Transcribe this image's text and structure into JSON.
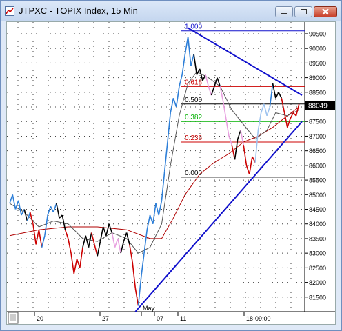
{
  "window": {
    "title": "JTPXC - TOPIX Index, 15 Min",
    "app_icon": "chart-app-icon",
    "buttons": {
      "minimize": "minimize-icon",
      "maximize": "maximize-icon",
      "close": "close-icon"
    }
  },
  "chart_data": {
    "type": "line",
    "symbol": "JTPXC",
    "y_ticks": [
      "90500",
      "90000",
      "89500",
      "89000",
      "88500",
      "88000",
      "87500",
      "87000",
      "86500",
      "86000",
      "85500",
      "85000",
      "84500",
      "84000",
      "83500",
      "83000",
      "82500",
      "82000",
      "81500"
    ],
    "current_price_label": "88049",
    "x_ticks": [
      "20",
      "27",
      "May",
      "07",
      "11",
      "18-09:00"
    ],
    "fibonacci_levels": [
      {
        "ratio": "1.000",
        "value": 90600,
        "color": "#1010cc"
      },
      {
        "ratio": "0.618",
        "value": 88700,
        "color": "#cc0000"
      },
      {
        "ratio": "0.500",
        "value": 88100,
        "color": "#000000"
      },
      {
        "ratio": "0.382",
        "value": 87500,
        "color": "#00b000"
      },
      {
        "ratio": "0.236",
        "value": 86800,
        "color": "#cc0000"
      },
      {
        "ratio": "0.000",
        "value": 85600,
        "color": "#000000"
      }
    ],
    "ylim": [
      81000,
      90900
    ],
    "price_series": [
      {
        "x": 0,
        "y": 84700,
        "c": "#2e7fd8"
      },
      {
        "x": 2,
        "y": 85000,
        "c": "#2e7fd8"
      },
      {
        "x": 4,
        "y": 84500,
        "c": "#2e7fd8"
      },
      {
        "x": 6,
        "y": 84800,
        "c": "#2e7fd8"
      },
      {
        "x": 8,
        "y": 84300,
        "c": "#2e7fd8"
      },
      {
        "x": 10,
        "y": 84500,
        "c": "#2e7fd8"
      },
      {
        "x": 12,
        "y": 84100,
        "c": "#000000"
      },
      {
        "x": 14,
        "y": 84400,
        "c": "#2e7fd8"
      },
      {
        "x": 16,
        "y": 84000,
        "c": "#cc0000"
      },
      {
        "x": 18,
        "y": 83300,
        "c": "#cc0000"
      },
      {
        "x": 20,
        "y": 83800,
        "c": "#cc0000"
      },
      {
        "x": 22,
        "y": 83200,
        "c": "#cc0000"
      },
      {
        "x": 24,
        "y": 83600,
        "c": "#2e7fd8"
      },
      {
        "x": 26,
        "y": 84300,
        "c": "#2e7fd8"
      },
      {
        "x": 28,
        "y": 84600,
        "c": "#2e7fd8"
      },
      {
        "x": 30,
        "y": 84400,
        "c": "#2e7fd8"
      },
      {
        "x": 32,
        "y": 84700,
        "c": "#2e7fd8"
      },
      {
        "x": 34,
        "y": 84200,
        "c": "#000000"
      },
      {
        "x": 36,
        "y": 84300,
        "c": "#000000"
      },
      {
        "x": 38,
        "y": 83800,
        "c": "#000000"
      },
      {
        "x": 40,
        "y": 83500,
        "c": "#cc0000"
      },
      {
        "x": 42,
        "y": 83000,
        "c": "#cc0000"
      },
      {
        "x": 44,
        "y": 82300,
        "c": "#cc0000"
      },
      {
        "x": 46,
        "y": 82800,
        "c": "#cc0000"
      },
      {
        "x": 48,
        "y": 82500,
        "c": "#cc0000"
      },
      {
        "x": 50,
        "y": 83200,
        "c": "#cc0000"
      },
      {
        "x": 52,
        "y": 83600,
        "c": "#000000"
      },
      {
        "x": 54,
        "y": 83200,
        "c": "#000000"
      },
      {
        "x": 56,
        "y": 83700,
        "c": "#000000"
      },
      {
        "x": 58,
        "y": 83300,
        "c": "#cc0000"
      },
      {
        "x": 60,
        "y": 82900,
        "c": "#cc0000"
      },
      {
        "x": 62,
        "y": 83400,
        "c": "#000000"
      },
      {
        "x": 64,
        "y": 83900,
        "c": "#000000"
      },
      {
        "x": 66,
        "y": 83600,
        "c": "#000000"
      },
      {
        "x": 68,
        "y": 84000,
        "c": "#000000"
      },
      {
        "x": 70,
        "y": 83700,
        "c": "#000000"
      },
      {
        "x": 72,
        "y": 83200,
        "c": "#e8a0e0"
      },
      {
        "x": 74,
        "y": 83500,
        "c": "#e8a0e0"
      },
      {
        "x": 76,
        "y": 83000,
        "c": "#e8a0e0"
      },
      {
        "x": 78,
        "y": 83400,
        "c": "#000000"
      },
      {
        "x": 80,
        "y": 83700,
        "c": "#000000"
      },
      {
        "x": 82,
        "y": 83300,
        "c": "#000000"
      },
      {
        "x": 84,
        "y": 82700,
        "c": "#cc0000"
      },
      {
        "x": 86,
        "y": 81800,
        "c": "#cc0000"
      },
      {
        "x": 88,
        "y": 81200,
        "c": "#cc0000"
      },
      {
        "x": 90,
        "y": 82200,
        "c": "#2e7fd8"
      },
      {
        "x": 92,
        "y": 83000,
        "c": "#2e7fd8"
      },
      {
        "x": 94,
        "y": 83800,
        "c": "#2e7fd8"
      },
      {
        "x": 96,
        "y": 84300,
        "c": "#2e7fd8"
      },
      {
        "x": 98,
        "y": 84000,
        "c": "#2e7fd8"
      },
      {
        "x": 100,
        "y": 84700,
        "c": "#2e7fd8"
      },
      {
        "x": 102,
        "y": 84300,
        "c": "#2e7fd8"
      },
      {
        "x": 104,
        "y": 84800,
        "c": "#2e7fd8"
      },
      {
        "x": 106,
        "y": 85800,
        "c": "#2e7fd8"
      },
      {
        "x": 108,
        "y": 86800,
        "c": "#2e7fd8"
      },
      {
        "x": 110,
        "y": 87800,
        "c": "#2e7fd8"
      },
      {
        "x": 112,
        "y": 88300,
        "c": "#2e7fd8"
      },
      {
        "x": 114,
        "y": 88000,
        "c": "#2e7fd8"
      },
      {
        "x": 116,
        "y": 88700,
        "c": "#2e7fd8"
      },
      {
        "x": 118,
        "y": 89100,
        "c": "#2e7fd8"
      },
      {
        "x": 120,
        "y": 89800,
        "c": "#2e7fd8"
      },
      {
        "x": 122,
        "y": 90400,
        "c": "#2e7fd8"
      },
      {
        "x": 124,
        "y": 89400,
        "c": "#2e7fd8"
      },
      {
        "x": 126,
        "y": 89800,
        "c": "#2e7fd8"
      },
      {
        "x": 128,
        "y": 89100,
        "c": "#000000"
      },
      {
        "x": 130,
        "y": 89300,
        "c": "#000000"
      },
      {
        "x": 132,
        "y": 88900,
        "c": "#000000"
      },
      {
        "x": 134,
        "y": 89100,
        "c": "#000000"
      },
      {
        "x": 136,
        "y": 88700,
        "c": "#e8a0e0"
      },
      {
        "x": 138,
        "y": 88400,
        "c": "#e8a0e0"
      },
      {
        "x": 140,
        "y": 88700,
        "c": "#000000"
      },
      {
        "x": 142,
        "y": 89000,
        "c": "#000000"
      },
      {
        "x": 144,
        "y": 88700,
        "c": "#000000"
      },
      {
        "x": 146,
        "y": 88200,
        "c": "#e8a0e0"
      },
      {
        "x": 148,
        "y": 87600,
        "c": "#e8a0e0"
      },
      {
        "x": 150,
        "y": 87000,
        "c": "#e8a0e0"
      },
      {
        "x": 152,
        "y": 86700,
        "c": "#e8a0e0"
      },
      {
        "x": 154,
        "y": 86200,
        "c": "#cc0000"
      },
      {
        "x": 156,
        "y": 86900,
        "c": "#000000"
      },
      {
        "x": 158,
        "y": 87200,
        "c": "#000000"
      },
      {
        "x": 160,
        "y": 86700,
        "c": "#e8a0e0"
      },
      {
        "x": 162,
        "y": 86000,
        "c": "#cc0000"
      },
      {
        "x": 164,
        "y": 85700,
        "c": "#cc0000"
      },
      {
        "x": 166,
        "y": 86300,
        "c": "#cc0000"
      },
      {
        "x": 168,
        "y": 86100,
        "c": "#cc0000"
      },
      {
        "x": 170,
        "y": 87200,
        "c": "#9ec3ef"
      },
      {
        "x": 172,
        "y": 87800,
        "c": "#9ec3ef"
      },
      {
        "x": 174,
        "y": 88100,
        "c": "#9ec3ef"
      },
      {
        "x": 176,
        "y": 87700,
        "c": "#9ec3ef"
      },
      {
        "x": 178,
        "y": 88000,
        "c": "#9ec3ef"
      },
      {
        "x": 180,
        "y": 88800,
        "c": "#2e7fd8"
      },
      {
        "x": 182,
        "y": 88300,
        "c": "#000000"
      },
      {
        "x": 184,
        "y": 88500,
        "c": "#000000"
      },
      {
        "x": 186,
        "y": 88300,
        "c": "#000000"
      },
      {
        "x": 188,
        "y": 87800,
        "c": "#cc0000"
      },
      {
        "x": 190,
        "y": 87300,
        "c": "#cc0000"
      },
      {
        "x": 192,
        "y": 87600,
        "c": "#cc0000"
      },
      {
        "x": 194,
        "y": 87800,
        "c": "#cc0000"
      },
      {
        "x": 196,
        "y": 87700,
        "c": "#cc0000"
      },
      {
        "x": 198,
        "y": 88100,
        "c": "#cc0000"
      }
    ],
    "x_max": 200,
    "ma_fast": [
      {
        "x": 0,
        "y": 84700
      },
      {
        "x": 10,
        "y": 84400
      },
      {
        "x": 20,
        "y": 83900
      },
      {
        "x": 30,
        "y": 84100
      },
      {
        "x": 40,
        "y": 84000
      },
      {
        "x": 50,
        "y": 83500
      },
      {
        "x": 60,
        "y": 83400
      },
      {
        "x": 70,
        "y": 83700
      },
      {
        "x": 80,
        "y": 83500
      },
      {
        "x": 88,
        "y": 83000
      },
      {
        "x": 96,
        "y": 83200
      },
      {
        "x": 104,
        "y": 84000
      },
      {
        "x": 110,
        "y": 86000
      },
      {
        "x": 116,
        "y": 87700
      },
      {
        "x": 122,
        "y": 88800
      },
      {
        "x": 128,
        "y": 89200
      },
      {
        "x": 136,
        "y": 89000
      },
      {
        "x": 144,
        "y": 88700
      },
      {
        "x": 152,
        "y": 87900
      },
      {
        "x": 160,
        "y": 87400
      },
      {
        "x": 168,
        "y": 86900
      },
      {
        "x": 176,
        "y": 87200
      },
      {
        "x": 182,
        "y": 87800
      },
      {
        "x": 190,
        "y": 87700
      },
      {
        "x": 198,
        "y": 87900
      }
    ],
    "ma_slow": [
      {
        "x": 0,
        "y": 83600
      },
      {
        "x": 20,
        "y": 83800
      },
      {
        "x": 40,
        "y": 83900
      },
      {
        "x": 60,
        "y": 83900
      },
      {
        "x": 80,
        "y": 83800
      },
      {
        "x": 96,
        "y": 83500
      },
      {
        "x": 104,
        "y": 83500
      },
      {
        "x": 112,
        "y": 84200
      },
      {
        "x": 120,
        "y": 85000
      },
      {
        "x": 130,
        "y": 85700
      },
      {
        "x": 140,
        "y": 86100
      },
      {
        "x": 150,
        "y": 86400
      },
      {
        "x": 160,
        "y": 86800
      },
      {
        "x": 170,
        "y": 87000
      },
      {
        "x": 180,
        "y": 87300
      },
      {
        "x": 190,
        "y": 87700
      },
      {
        "x": 198,
        "y": 88000
      }
    ],
    "trend_lines": [
      {
        "from": {
          "x": 86,
          "y": 81000
        },
        "to": {
          "x": 200,
          "y": 87500
        }
      },
      {
        "from": {
          "x": 122,
          "y": 90700
        },
        "to": {
          "x": 200,
          "y": 88400
        }
      }
    ],
    "grid": "dotted"
  }
}
